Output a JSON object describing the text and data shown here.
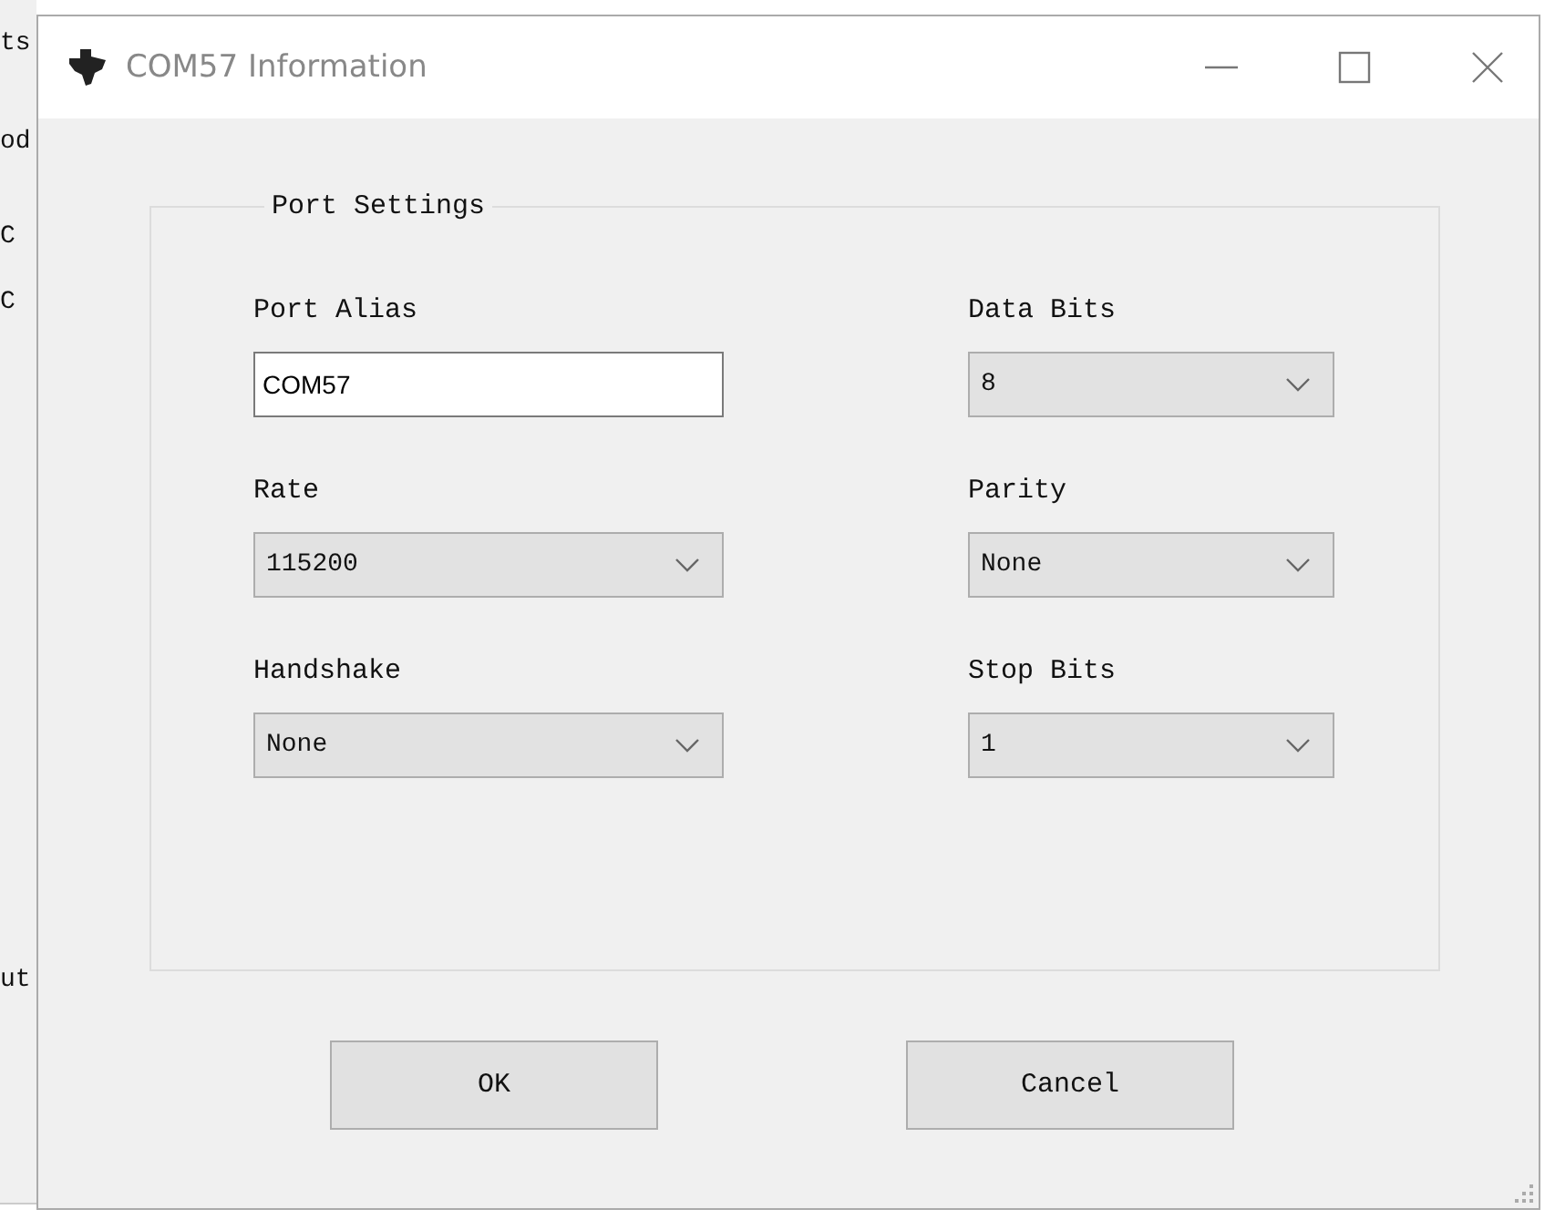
{
  "background_window": {
    "fragments": [
      "ts",
      "od",
      "C",
      "C",
      "ut"
    ]
  },
  "window": {
    "title": "COM57 Information"
  },
  "group": {
    "title": "Port Settings",
    "fields": [
      {
        "label": "Port Alias",
        "kind": "text",
        "value": "COM57"
      },
      {
        "label": "Data Bits",
        "kind": "combo",
        "value": "8"
      },
      {
        "label": "Rate",
        "kind": "combo",
        "value": "115200"
      },
      {
        "label": "Parity",
        "kind": "combo",
        "value": "None"
      },
      {
        "label": "Handshake",
        "kind": "combo",
        "value": "None"
      },
      {
        "label": "Stop Bits",
        "kind": "combo",
        "value": "1"
      }
    ]
  },
  "buttons": [
    "OK",
    "Cancel"
  ]
}
